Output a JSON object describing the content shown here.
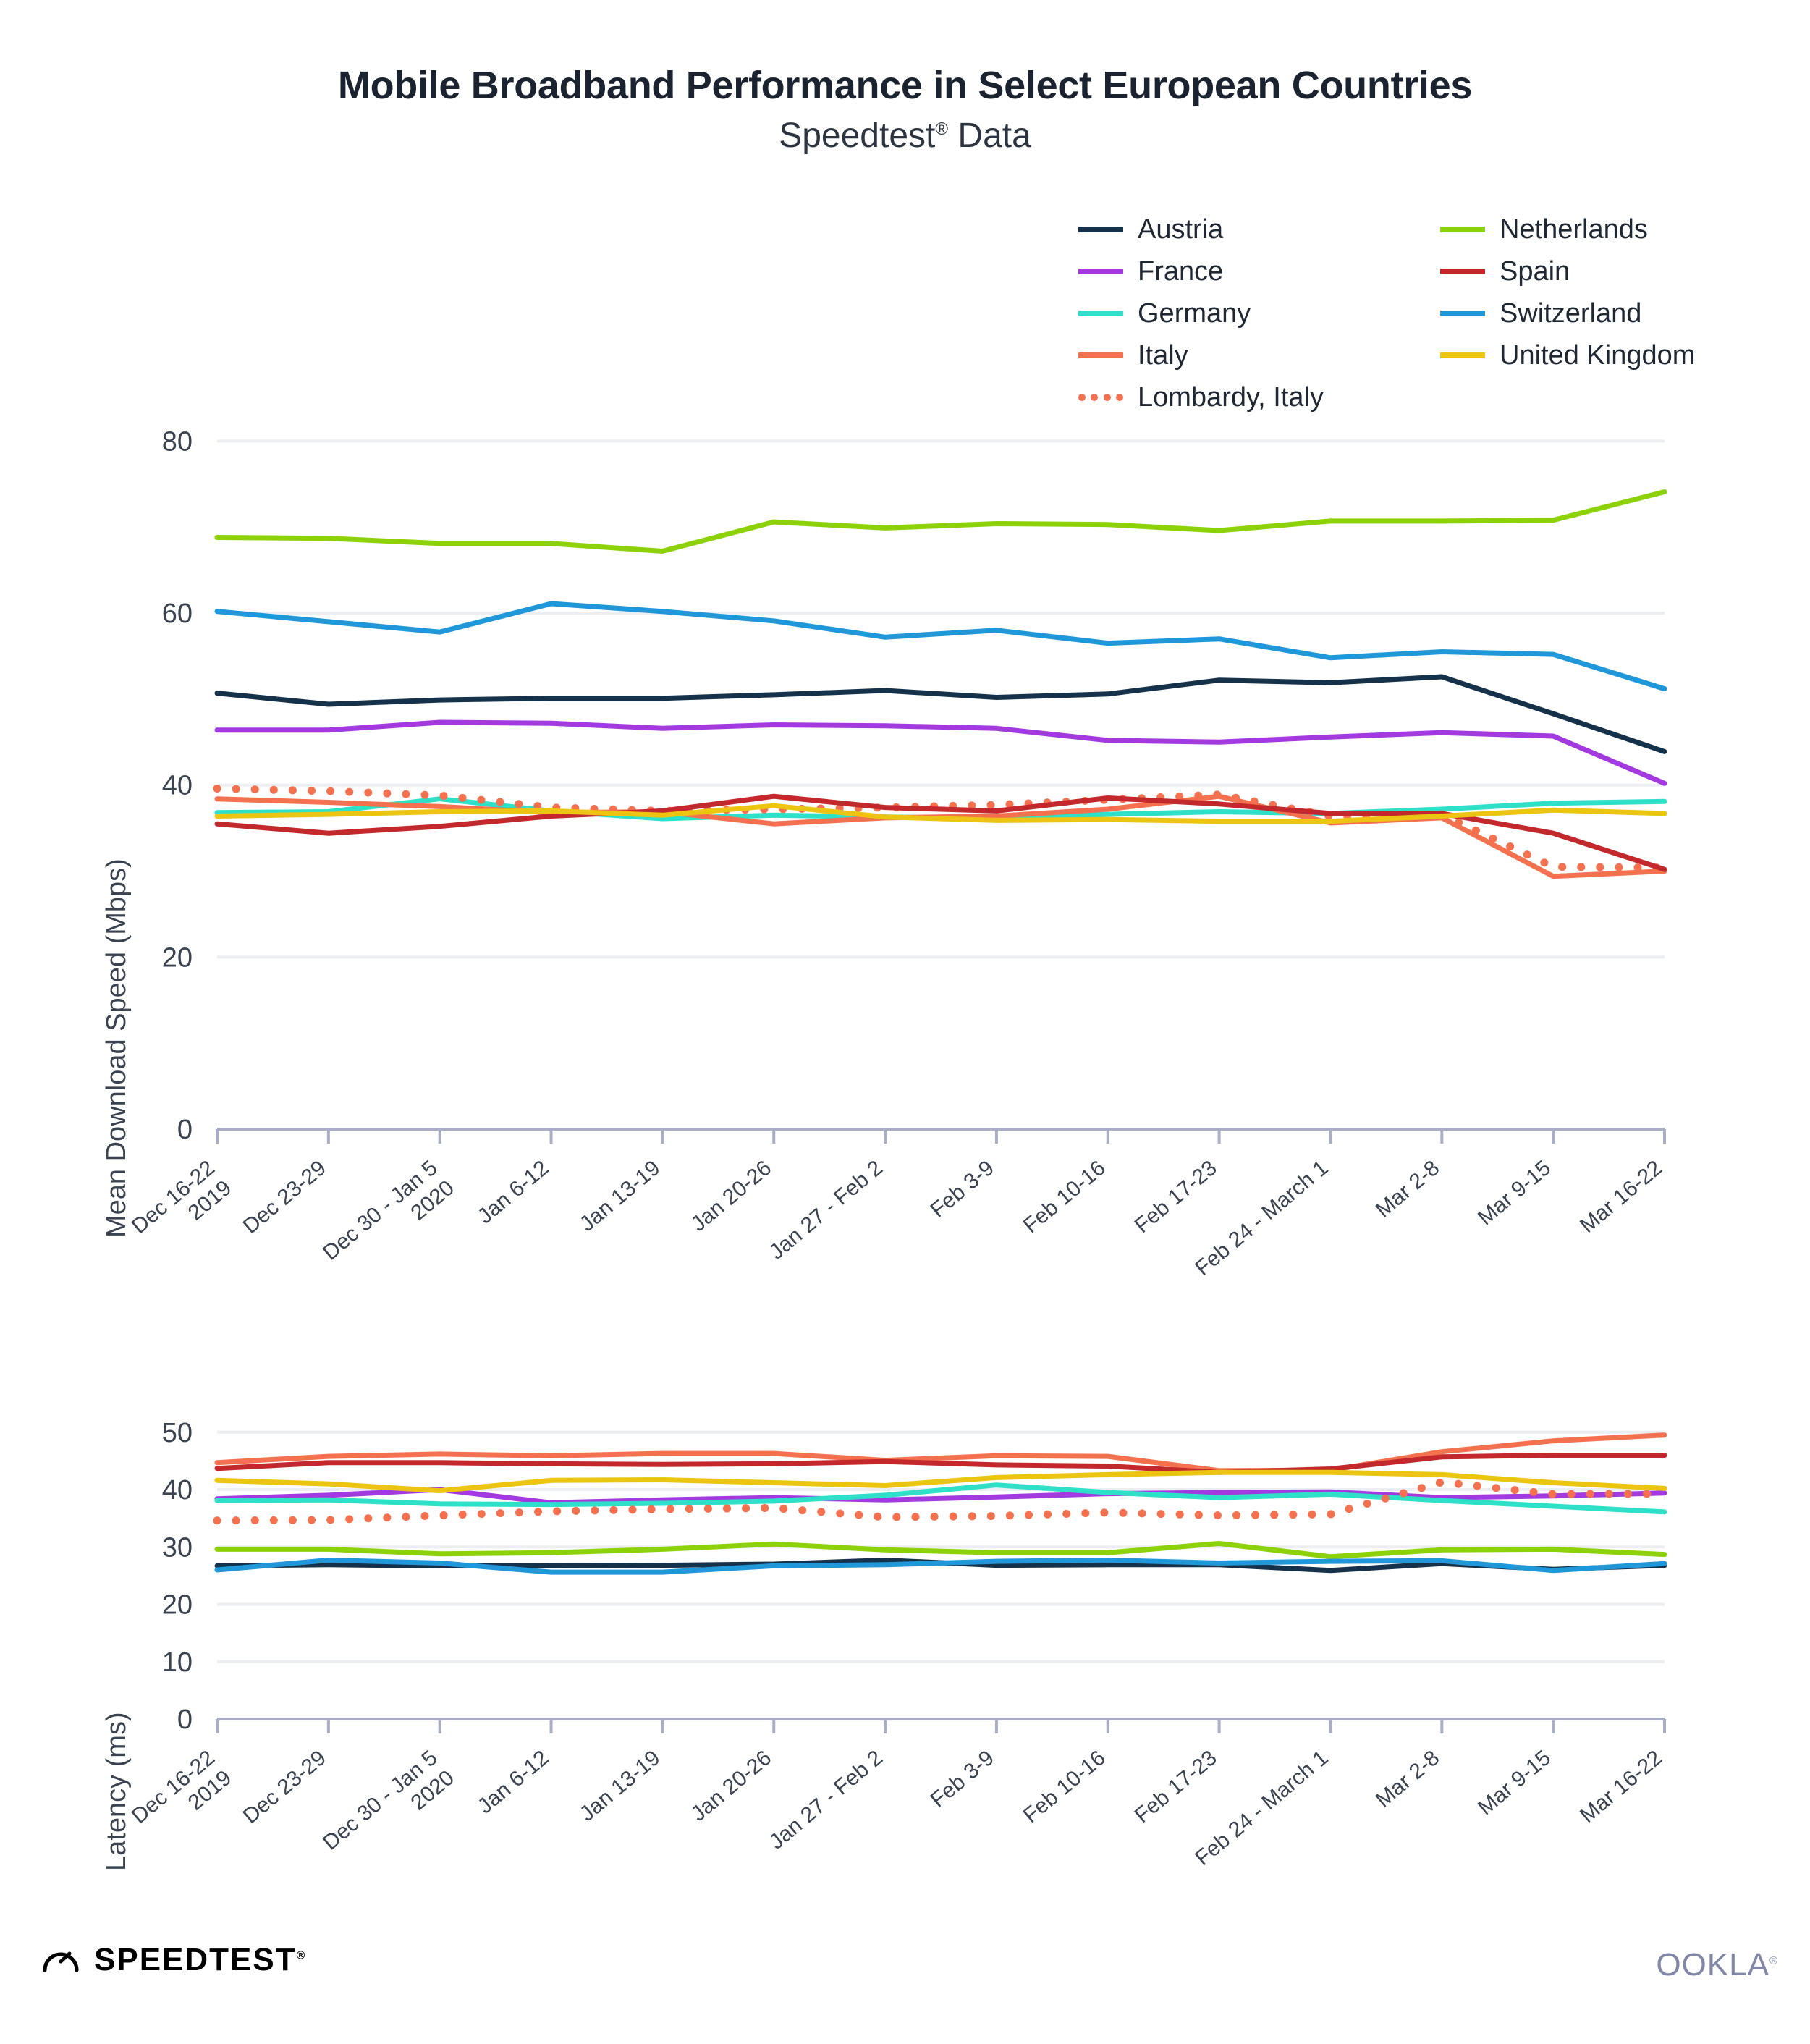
{
  "header": {
    "title": "Mobile Broadband Performance in Select European Countries",
    "subtitle": "Speedtest",
    "subtitle_mark": "®",
    "subtitle_tail": " Data"
  },
  "legend": {
    "items": [
      {
        "label": "Austria",
        "color": "#16314a",
        "style": "solid",
        "col": 1
      },
      {
        "label": "Netherlands",
        "color": "#8dd109",
        "style": "solid",
        "col": 2
      },
      {
        "label": "France",
        "color": "#a23ae0",
        "style": "solid",
        "col": 1
      },
      {
        "label": "Spain",
        "color": "#c3292c",
        "style": "solid",
        "col": 2
      },
      {
        "label": "Germany",
        "color": "#2ee0c8",
        "style": "solid",
        "col": 1
      },
      {
        "label": "Switzerland",
        "color": "#1f97d9",
        "style": "solid",
        "col": 2
      },
      {
        "label": "Italy",
        "color": "#f4714f",
        "style": "solid",
        "col": 1
      },
      {
        "label": "United Kingdom",
        "color": "#ecc512",
        "style": "solid",
        "col": 2
      },
      {
        "label": "Lombardy, Italy",
        "color": "#f4714f",
        "style": "dotted",
        "col": 1
      }
    ]
  },
  "footer": {
    "speedtest_label": "SPEEDTEST",
    "speedtest_mark": "®",
    "ookla_label": "OOKLA",
    "ookla_mark": "®"
  },
  "chart_data": [
    {
      "id": "download",
      "type": "line",
      "title": "",
      "xlabel": "",
      "ylabel": "Mean Download Speed (Mbps)",
      "ylim": [
        0,
        85
      ],
      "yticks": [
        0,
        20,
        40,
        60,
        80
      ],
      "grid": true,
      "legend_position": "top-right",
      "categories": [
        "Dec 16-22\n2019",
        "Dec 23-29",
        "Dec 30 - Jan 5\n2020",
        "Jan 6-12",
        "Jan 13-19",
        "Jan 20-26",
        "Jan 27 - Feb 2",
        "Feb 3-9",
        "Feb 10-16",
        "Feb 17-23",
        "Feb 24 - March 1",
        "Mar 2-8",
        "Mar 9-15",
        "Mar 16-22"
      ],
      "series": [
        {
          "name": "Austria",
          "color": "#16314a",
          "style": "solid",
          "values": [
            50.7,
            49.4,
            49.9,
            50.1,
            50.1,
            50.5,
            51.0,
            50.2,
            50.6,
            52.2,
            51.9,
            52.6,
            48.3,
            43.9
          ]
        },
        {
          "name": "France",
          "color": "#a23ae0",
          "style": "solid",
          "values": [
            46.4,
            46.4,
            47.3,
            47.2,
            46.6,
            47.0,
            46.9,
            46.6,
            45.2,
            45.0,
            45.6,
            46.1,
            45.7,
            40.2
          ]
        },
        {
          "name": "Germany",
          "color": "#2ee0c8",
          "style": "solid",
          "values": [
            36.8,
            36.9,
            38.4,
            37.0,
            36.1,
            36.5,
            36.3,
            36.1,
            36.6,
            36.9,
            36.7,
            37.2,
            37.9,
            38.1
          ]
        },
        {
          "name": "Italy",
          "color": "#f4714f",
          "style": "solid",
          "values": [
            38.4,
            38.0,
            37.5,
            36.8,
            36.9,
            35.5,
            36.2,
            36.4,
            37.2,
            38.7,
            35.6,
            36.2,
            29.4,
            30.0
          ]
        },
        {
          "name": "Lombardy, Italy",
          "color": "#f4714f",
          "style": "dotted",
          "values": [
            39.6,
            39.3,
            38.8,
            37.4,
            37.0,
            37.2,
            37.4,
            37.7,
            38.3,
            38.9,
            36.4,
            36.6,
            30.5,
            30.4
          ]
        },
        {
          "name": "Netherlands",
          "color": "#8dd109",
          "style": "solid",
          "values": [
            68.8,
            68.7,
            68.1,
            68.1,
            67.2,
            70.6,
            69.9,
            70.4,
            70.3,
            69.6,
            70.7,
            70.7,
            70.8,
            74.1
          ]
        },
        {
          "name": "Spain",
          "color": "#c3292c",
          "style": "solid",
          "values": [
            35.5,
            34.4,
            35.2,
            36.4,
            37.0,
            38.7,
            37.4,
            37.0,
            38.5,
            37.8,
            36.7,
            36.7,
            34.4,
            30.2
          ]
        },
        {
          "name": "Switzerland",
          "color": "#1f97d9",
          "style": "solid",
          "values": [
            60.2,
            59.0,
            57.8,
            61.1,
            60.2,
            59.1,
            57.2,
            58.0,
            56.5,
            57.0,
            54.8,
            55.5,
            55.2,
            51.2
          ]
        },
        {
          "name": "United Kingdom",
          "color": "#ecc512",
          "style": "solid",
          "values": [
            36.4,
            36.6,
            36.9,
            37.0,
            36.5,
            37.6,
            36.3,
            35.9,
            36.0,
            35.8,
            35.8,
            36.4,
            37.1,
            36.7
          ]
        }
      ]
    },
    {
      "id": "latency",
      "type": "line",
      "title": "",
      "xlabel": "",
      "ylabel": "Latency (ms)",
      "ylim": [
        0,
        53
      ],
      "yticks": [
        0,
        10,
        20,
        30,
        40,
        50
      ],
      "grid": true,
      "legend_position": "shared-top",
      "categories": [
        "Dec 16-22\n2019",
        "Dec 23-29",
        "Dec 30 - Jan 5\n2020",
        "Jan 6-12",
        "Jan 13-19",
        "Jan 20-26",
        "Jan 27 - Feb 2",
        "Feb 3-9",
        "Feb 10-16",
        "Feb 17-23",
        "Feb 24 - March 1",
        "Mar 2-8",
        "Mar 9-15",
        "Mar 16-22"
      ],
      "series": [
        {
          "name": "Austria",
          "color": "#16314a",
          "style": "solid",
          "values": [
            26.7,
            26.9,
            26.7,
            26.7,
            26.8,
            27.0,
            27.7,
            26.8,
            26.9,
            26.9,
            25.9,
            27.1,
            26.1,
            26.8
          ]
        },
        {
          "name": "France",
          "color": "#a23ae0",
          "style": "solid",
          "values": [
            38.4,
            39.0,
            40.0,
            37.7,
            38.2,
            38.6,
            38.2,
            38.7,
            39.3,
            39.5,
            39.6,
            38.6,
            38.9,
            39.4
          ]
        },
        {
          "name": "Germany",
          "color": "#2ee0c8",
          "style": "solid",
          "values": [
            38.1,
            38.2,
            37.5,
            37.4,
            37.6,
            38.0,
            39.0,
            40.8,
            39.5,
            38.6,
            39.2,
            38.1,
            37.1,
            36.1
          ]
        },
        {
          "name": "Italy",
          "color": "#f4714f",
          "style": "solid",
          "values": [
            44.7,
            45.8,
            46.2,
            45.9,
            46.3,
            46.3,
            45.1,
            45.9,
            45.8,
            43.3,
            43.4,
            46.6,
            48.5,
            49.5
          ]
        },
        {
          "name": "Lombardy, Italy",
          "color": "#f4714f",
          "style": "dotted",
          "values": [
            34.6,
            34.7,
            35.5,
            36.2,
            36.6,
            36.8,
            35.2,
            35.4,
            36.0,
            35.5,
            35.7,
            41.3,
            39.2,
            39.3
          ]
        },
        {
          "name": "Netherlands",
          "color": "#8dd109",
          "style": "solid",
          "values": [
            29.6,
            29.6,
            28.8,
            29.0,
            29.6,
            30.5,
            29.5,
            29.0,
            29.0,
            30.6,
            28.3,
            29.5,
            29.6,
            28.7
          ]
        },
        {
          "name": "Spain",
          "color": "#c3292c",
          "style": "solid",
          "values": [
            43.7,
            44.7,
            44.7,
            44.5,
            44.4,
            44.5,
            44.9,
            44.3,
            44.1,
            43.0,
            43.6,
            45.7,
            46.0,
            46.0
          ]
        },
        {
          "name": "Switzerland",
          "color": "#1f97d9",
          "style": "solid",
          "values": [
            26.0,
            27.7,
            27.2,
            25.6,
            25.6,
            26.7,
            26.9,
            27.5,
            27.7,
            27.2,
            27.5,
            27.6,
            25.9,
            27.1
          ]
        },
        {
          "name": "United Kingdom",
          "color": "#ecc512",
          "style": "solid",
          "values": [
            41.6,
            41.0,
            39.8,
            41.6,
            41.7,
            41.2,
            40.7,
            42.1,
            42.6,
            43.0,
            43.0,
            42.6,
            41.2,
            40.2
          ]
        }
      ]
    }
  ]
}
